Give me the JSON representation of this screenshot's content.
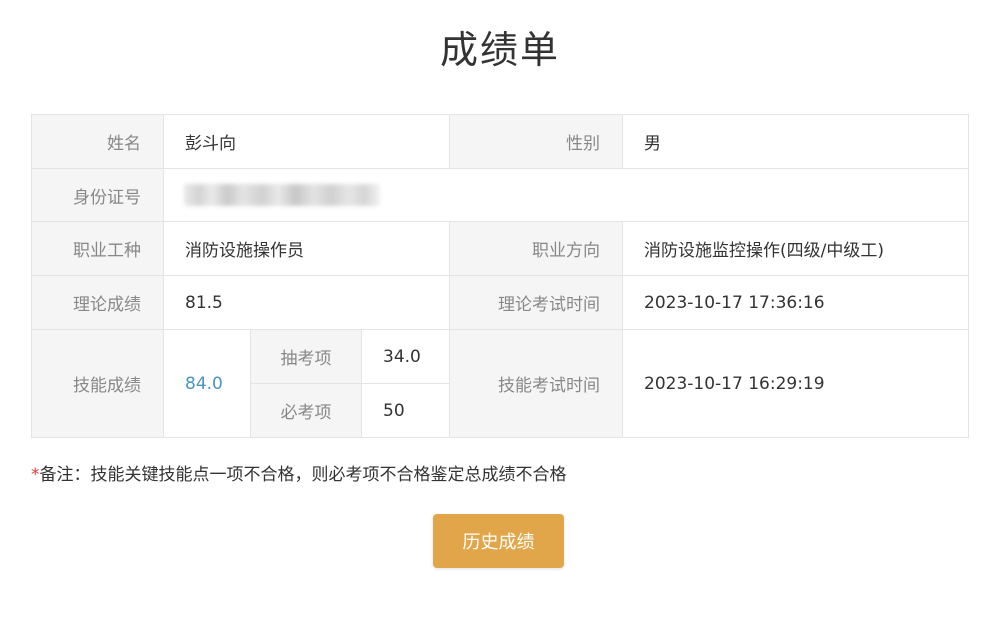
{
  "page": {
    "title": "成绩单"
  },
  "table": {
    "name_label": "姓名",
    "name_value": "彭斗向",
    "gender_label": "性别",
    "gender_value": "男",
    "id_label": "身份证号",
    "occupation_label": "职业工种",
    "occupation_value": "消防设施操作员",
    "direction_label": "职业方向",
    "direction_value": "消防设施监控操作(四级/中级工)",
    "theory_label": "理论成绩",
    "theory_value": "81.5",
    "theory_time_label": "理论考试时间",
    "theory_time_value": "2023-10-17 17:36:16",
    "skill_label": "技能成绩",
    "skill_value": "84.0",
    "draw_label": "抽考项",
    "draw_value": "34.0",
    "required_label": "必考项",
    "required_value": "50",
    "skill_time_label": "技能考试时间",
    "skill_time_value": "2023-10-17 16:29:19"
  },
  "note": {
    "star": "*",
    "text": "备注：技能关键技能点一项不合格，则必考项不合格鉴定总成绩不合格"
  },
  "actions": {
    "history_label": "历史成绩"
  },
  "colors": {
    "accent": "#e2a64a",
    "link": "#4a94c5",
    "required_star": "#e53935"
  }
}
